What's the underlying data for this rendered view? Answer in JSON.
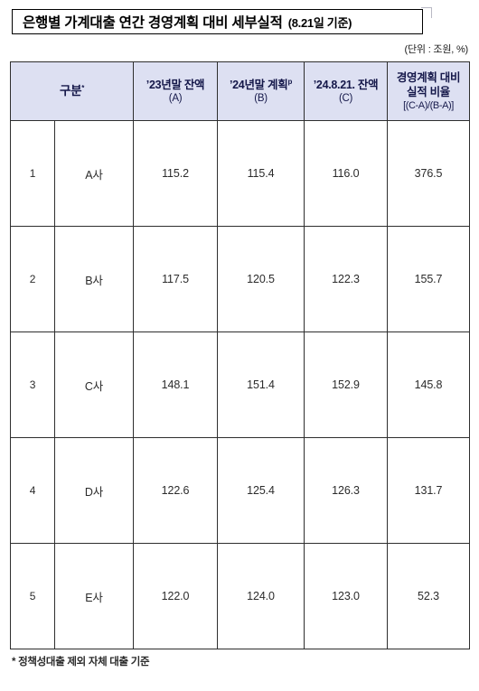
{
  "title": {
    "main": "은행별 가계대출 연간 경영계획 대비 세부실적",
    "sub": "(8.21일 기준)"
  },
  "unit_note": "(단위 : 조원, %)",
  "footnote": "* 정책성대출 제외 자체 대출 기준",
  "colors": {
    "header_bg": "#dde0f2",
    "header_text": "#15184a",
    "border": "#2e2e2e"
  },
  "table": {
    "headers": {
      "gubun": "구분",
      "gubun_sup": "*",
      "col_a_line1": "’23년말 잔액",
      "col_a_line2": "(A)",
      "col_b_line1": "’24년말 계획",
      "col_b_sup": "p",
      "col_b_line2": "(B)",
      "col_c_line1": "’24.8.21. 잔액",
      "col_c_line2": "(C)",
      "col_ratio_line1": "경영계획 대비",
      "col_ratio_line2": "실적 비율",
      "col_ratio_line3": "[(C-A)/(B-A)]"
    },
    "rows": [
      {
        "no": "1",
        "name": "A사",
        "a": "115.2",
        "b": "115.4",
        "c": "116.0",
        "ratio": "376.5"
      },
      {
        "no": "2",
        "name": "B사",
        "a": "117.5",
        "b": "120.5",
        "c": "122.3",
        "ratio": "155.7"
      },
      {
        "no": "3",
        "name": "C사",
        "a": "148.1",
        "b": "151.4",
        "c": "152.9",
        "ratio": "145.8"
      },
      {
        "no": "4",
        "name": "D사",
        "a": "122.6",
        "b": "125.4",
        "c": "126.3",
        "ratio": "131.7"
      },
      {
        "no": "5",
        "name": "E사",
        "a": "122.0",
        "b": "124.0",
        "c": "123.0",
        "ratio": "52.3"
      }
    ]
  }
}
